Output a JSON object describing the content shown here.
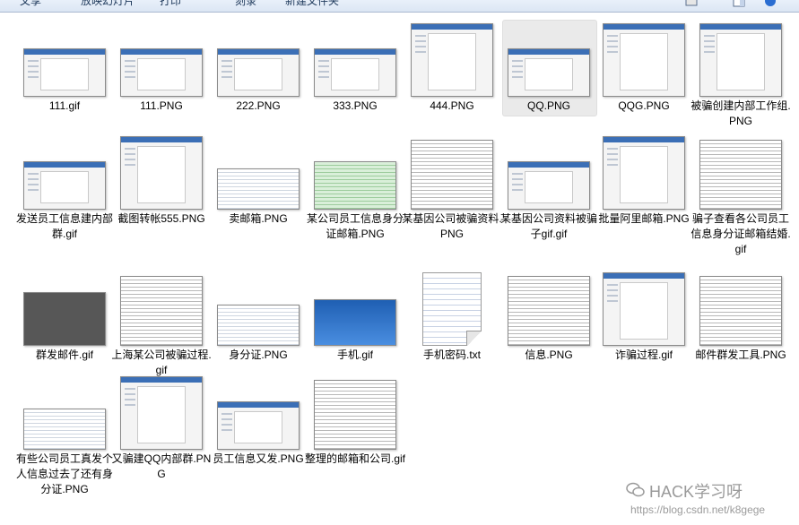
{
  "toolbar": {
    "items": [
      "文享",
      "放映幻灯片",
      "打印",
      "刻录",
      "新建文件夹"
    ]
  },
  "files": [
    {
      "name": "111.gif",
      "thumb": "window"
    },
    {
      "name": "111.PNG",
      "thumb": "window"
    },
    {
      "name": "222.PNG",
      "thumb": "window"
    },
    {
      "name": "333.PNG",
      "thumb": "window"
    },
    {
      "name": "444.PNG",
      "thumb": "doc"
    },
    {
      "name": "QQ.PNG",
      "thumb": "window",
      "selected": true
    },
    {
      "name": "QQG.PNG",
      "thumb": "doc"
    },
    {
      "name": "被骗创建内部工作组.PNG",
      "thumb": "doc"
    },
    {
      "name": "发送员工信息建内部群.gif",
      "thumb": "window"
    },
    {
      "name": "截图转帐555.PNG",
      "thumb": "doc"
    },
    {
      "name": "卖邮箱.PNG",
      "thumb": "grid"
    },
    {
      "name": "某公司员工信息身分证邮箱.PNG",
      "thumb": "green"
    },
    {
      "name": "某基因公司被骗资料.PNG",
      "thumb": "grid2"
    },
    {
      "name": "某基因公司资料被骗子gif.gif",
      "thumb": "window"
    },
    {
      "name": "批量阿里邮箱.PNG",
      "thumb": "doc"
    },
    {
      "name": "骗子查看各公司员工信息身分证邮箱结婚.gif",
      "thumb": "grid2"
    },
    {
      "name": "群发邮件.gif",
      "thumb": "dark"
    },
    {
      "name": "上海某公司被骗过程.gif",
      "thumb": "grid2"
    },
    {
      "name": "身分证.PNG",
      "thumb": "grid"
    },
    {
      "name": "手机.gif",
      "thumb": "blue"
    },
    {
      "name": "手机密码.txt",
      "thumb": "txt"
    },
    {
      "name": "信息.PNG",
      "thumb": "grid2"
    },
    {
      "name": "诈骗过程.gif",
      "thumb": "doc"
    },
    {
      "name": "邮件群发工具.PNG",
      "thumb": "grid2"
    },
    {
      "name": "有些公司员工真发个人信息过去了还有身分证.PNG",
      "thumb": "grid"
    },
    {
      "name": "又骗建QQ内部群.PNG",
      "thumb": "doc"
    },
    {
      "name": "员工信息又发.PNG",
      "thumb": "window"
    },
    {
      "name": "整理的邮箱和公司.gif",
      "thumb": "grid2"
    }
  ],
  "watermark": {
    "title": "HACK学习呀",
    "url": "https://blog.csdn.net/k8gege"
  }
}
